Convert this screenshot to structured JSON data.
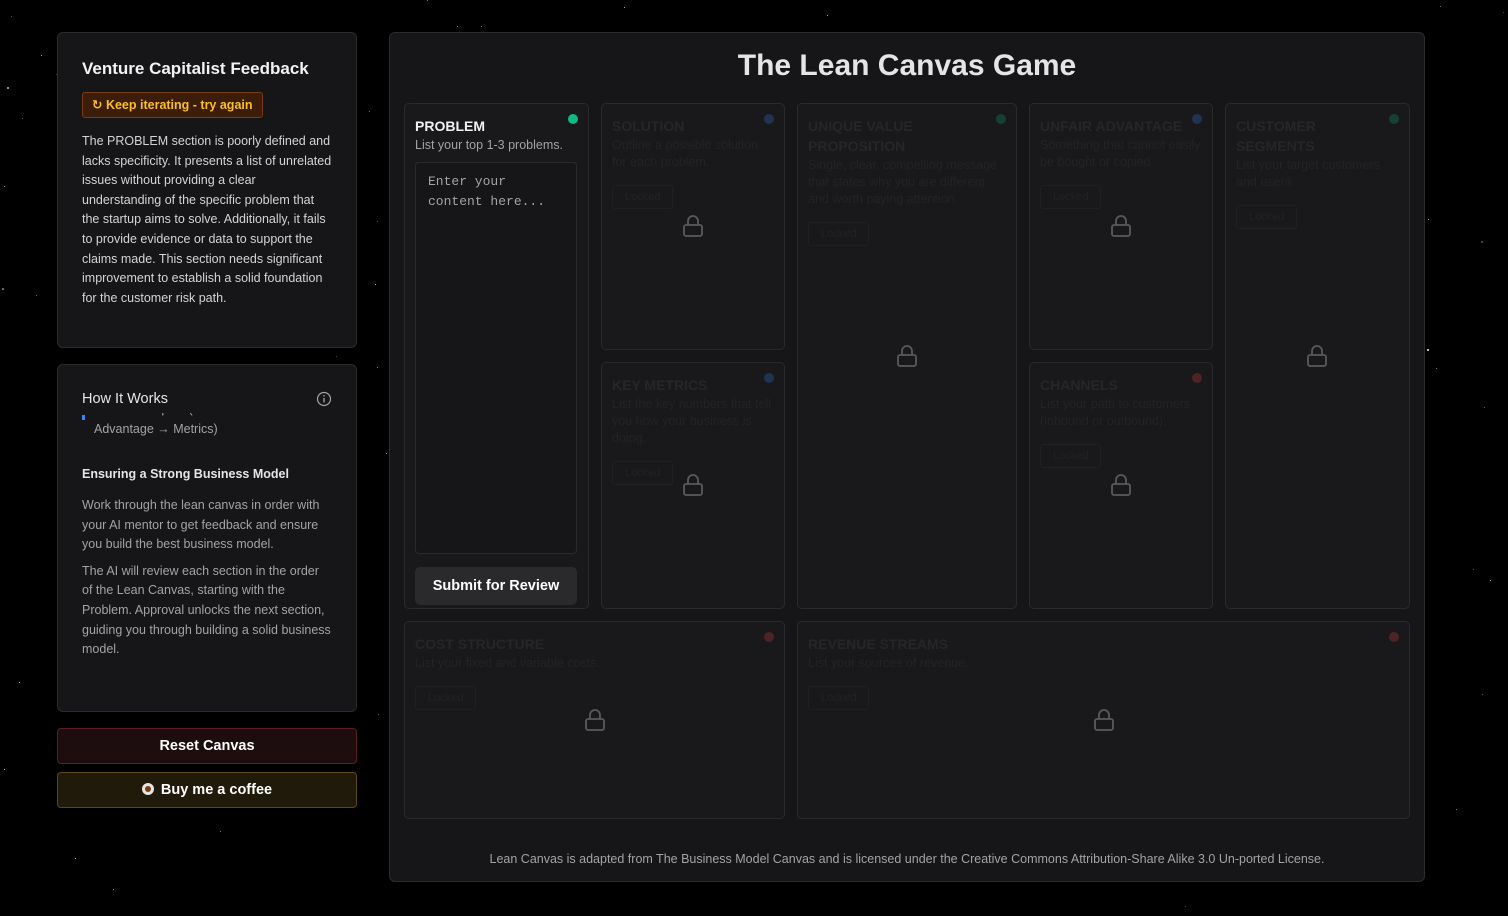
{
  "feedback": {
    "title": "Venture Capitalist Feedback",
    "badge": "↻ Keep iterating - try again",
    "badge_color": "#fbbf24",
    "text": "The PROBLEM section is poorly defined and lacks specificity. It presents a list of unrelated issues without providing a clear understanding of the specific problem that the startup aims to solve. Additionally, it fails to provide evidence or data to support the claims made. This section needs significant improvement to establish a solid foundation for the customer risk path."
  },
  "how_it_works": {
    "title": "How It Works",
    "clipped_item": "and is it unique? (Solution → Unfair Advantage → Metrics)",
    "heading": "Ensuring a Strong Business Model",
    "para1": "Work through the lean canvas in order with your AI mentor to get feedback and ensure you build the best business model.",
    "para2": "The AI will review each section in the order of the Lean Canvas, starting with the Problem. Approval unlocks the next section, guiding you through building a solid business model."
  },
  "buttons": {
    "reset": "Reset Canvas",
    "coffee": "Buy me a coffee"
  },
  "main": {
    "title": "The Lean Canvas Game",
    "footer": "Lean Canvas is adapted from The Business Model Canvas and is licensed under the Creative Commons Attribution-Share Alike 3.0 Un-ported License."
  },
  "sections": {
    "problem": {
      "title": "PROBLEM",
      "desc": "List your top 1-3 problems.",
      "placeholder": "Enter your content here...",
      "submit": "Submit for Review",
      "color": "#10b981"
    },
    "solution": {
      "title": "SOLUTION",
      "desc": "Outline a possible solution for each problem.",
      "ghost": "Locked",
      "color": "#3b82f6"
    },
    "uvp": {
      "title": "UNIQUE VALUE PROPOSITION",
      "desc": "Single, clear, compelling message that states why you are different and worth paying attention.",
      "ghost": "Locked",
      "color": "#10b981"
    },
    "unfair": {
      "title": "UNFAIR ADVANTAGE",
      "desc": "Something that cannot easily be bought or copied.",
      "ghost": "Locked",
      "color": "#3b82f6"
    },
    "segments": {
      "title": "CUSTOMER SEGMENTS",
      "desc": "List your target customers and users.",
      "ghost": "Locked",
      "color": "#10b981"
    },
    "metrics": {
      "title": "KEY METRICS",
      "desc": "List the key numbers that tell you how your business is doing.",
      "ghost": "Locked",
      "color": "#3b82f6"
    },
    "channels": {
      "title": "CHANNELS",
      "desc": "List your path to customers (inbound or outbound).",
      "ghost": "Locked",
      "color": "#ef4444"
    },
    "cost": {
      "title": "COST STRUCTURE",
      "desc": "List your fixed and variable costs.",
      "ghost": "Locked",
      "color": "#ef4444"
    },
    "revenue": {
      "title": "REVENUE STREAMS",
      "desc": "List your sources of revenue.",
      "ghost": "Locked",
      "color": "#ef4444"
    }
  }
}
